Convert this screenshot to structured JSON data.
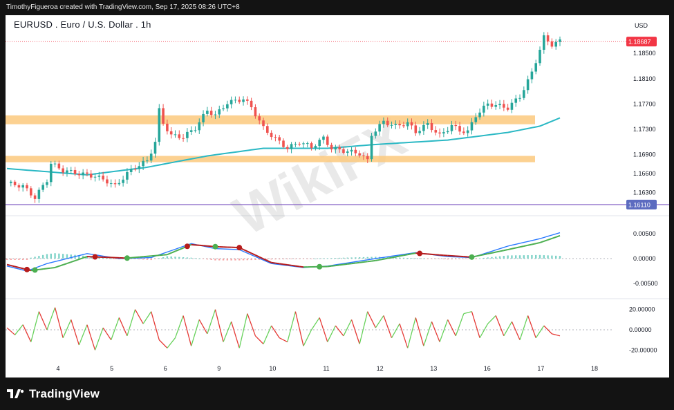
{
  "header": {
    "attribution": "TimothyFigueroa created with TradingView.com, Sep 17, 2025 08:26 UTC+8"
  },
  "chart_title": "EURUSD . Euro / U.S. Dollar . 1h",
  "currency_label": "USD",
  "brand": {
    "name": "TradingView",
    "watermark": "WikiFX"
  },
  "colors": {
    "up": "#26a69a",
    "down": "#ef5350",
    "ma": "#2ab8c4",
    "zone": "#fcc97e",
    "macd_line": "#2979ff",
    "signal_up": "#4caf50",
    "signal_down": "#b71c1c",
    "rsi_up": "#66d15a",
    "rsi_down": "#e53935",
    "support_line": "#7e57c2",
    "last_price_tag": "#f23645",
    "support_tag": "#5c6bc0"
  },
  "chart_data": {
    "type": "candlestick",
    "timeframe": "1h",
    "x_ticks": [
      "4",
      "5",
      "6",
      "9",
      "10",
      "11",
      "12",
      "13",
      "16",
      "17",
      "18"
    ],
    "price_axis": {
      "ticks": [
        "1.18500",
        "1.18100",
        "1.17700",
        "1.17300",
        "1.16900",
        "1.16600",
        "1.16300"
      ],
      "ylim": [
        1.16,
        1.1895
      ]
    },
    "last_price": "1.18687",
    "support_level": "1.16110",
    "zones": [
      {
        "low": 1.1738,
        "high": 1.1752
      },
      {
        "low": 1.1678,
        "high": 1.1688
      }
    ],
    "price_path": [
      [
        0,
        1.1645
      ],
      [
        4,
        1.164
      ],
      [
        7,
        1.1622
      ],
      [
        10,
        1.165
      ],
      [
        11,
        1.1676
      ],
      [
        14,
        1.1665
      ],
      [
        18,
        1.166
      ],
      [
        22,
        1.1656
      ],
      [
        25,
        1.1648
      ],
      [
        27,
        1.164
      ],
      [
        30,
        1.166
      ],
      [
        32,
        1.167
      ],
      [
        35,
        1.168
      ],
      [
        37,
        1.171
      ],
      [
        38,
        1.176
      ],
      [
        39,
        1.174
      ],
      [
        41,
        1.172
      ],
      [
        44,
        1.1718
      ],
      [
        47,
        1.1732
      ],
      [
        50,
        1.176
      ],
      [
        52,
        1.1752
      ],
      [
        55,
        1.1772
      ],
      [
        59,
        1.1778
      ],
      [
        61,
        1.1765
      ],
      [
        64,
        1.1732
      ],
      [
        67,
        1.1715
      ],
      [
        70,
        1.17
      ],
      [
        73,
        1.171
      ],
      [
        76,
        1.1702
      ],
      [
        79,
        1.1716
      ],
      [
        81,
        1.17
      ],
      [
        85,
        1.1695
      ],
      [
        88,
        1.1692
      ],
      [
        90,
        1.168
      ],
      [
        91,
        1.1722
      ],
      [
        94,
        1.1742
      ],
      [
        97,
        1.1735
      ],
      [
        100,
        1.174
      ],
      [
        102,
        1.1726
      ],
      [
        105,
        1.1738
      ],
      [
        108,
        1.172
      ],
      [
        111,
        1.1736
      ],
      [
        113,
        1.1728
      ],
      [
        115,
        1.1726
      ],
      [
        117,
        1.1752
      ],
      [
        120,
        1.177
      ],
      [
        122,
        1.1768
      ],
      [
        125,
        1.1764
      ],
      [
        128,
        1.1782
      ],
      [
        130,
        1.1806
      ],
      [
        131,
        1.182
      ],
      [
        133,
        1.1856
      ],
      [
        134,
        1.1875
      ],
      [
        136,
        1.1864
      ],
      [
        138,
        1.1869
      ]
    ],
    "ma_path": [
      [
        0,
        1.1668
      ],
      [
        20,
        1.1658
      ],
      [
        35,
        1.167
      ],
      [
        50,
        1.1688
      ],
      [
        64,
        1.17
      ],
      [
        80,
        1.17
      ],
      [
        92,
        1.1706
      ],
      [
        110,
        1.1713
      ],
      [
        125,
        1.1725
      ],
      [
        133,
        1.1735
      ],
      [
        138,
        1.1748
      ]
    ],
    "macd": {
      "ticks": [
        "0.00500",
        "0.00000",
        "-0.00500"
      ],
      "ylim": [
        -0.0075,
        0.0075
      ],
      "macd_path": [
        [
          0,
          -0.0015
        ],
        [
          5,
          -0.0025
        ],
        [
          10,
          -0.001
        ],
        [
          20,
          0.001
        ],
        [
          28,
          0.0
        ],
        [
          36,
          0.0002
        ],
        [
          46,
          0.003
        ],
        [
          52,
          0.002
        ],
        [
          58,
          0.0018
        ],
        [
          66,
          -0.001
        ],
        [
          74,
          -0.0018
        ],
        [
          80,
          -0.0015
        ],
        [
          92,
          0.0
        ],
        [
          102,
          0.0012
        ],
        [
          110,
          0.0004
        ],
        [
          116,
          0.0002
        ],
        [
          125,
          0.0025
        ],
        [
          133,
          0.004
        ],
        [
          138,
          0.0052
        ]
      ],
      "signal_path": [
        [
          0,
          -0.0012
        ],
        [
          6,
          -0.0024
        ],
        [
          12,
          -0.0018
        ],
        [
          20,
          0.0004
        ],
        [
          30,
          0.0001
        ],
        [
          40,
          0.0008
        ],
        [
          46,
          0.0028
        ],
        [
          52,
          0.0024
        ],
        [
          58,
          0.0022
        ],
        [
          66,
          -0.0008
        ],
        [
          74,
          -0.0017
        ],
        [
          80,
          -0.0016
        ],
        [
          92,
          -0.0004
        ],
        [
          102,
          0.0011
        ],
        [
          110,
          0.0006
        ],
        [
          116,
          0.0003
        ],
        [
          125,
          0.0018
        ],
        [
          133,
          0.0032
        ],
        [
          138,
          0.0046
        ]
      ],
      "cross_points": [
        {
          "x": 5,
          "dir": "down"
        },
        {
          "x": 7,
          "dir": "up"
        },
        {
          "x": 22,
          "dir": "down"
        },
        {
          "x": 30,
          "dir": "up"
        },
        {
          "x": 45,
          "dir": "down"
        },
        {
          "x": 52,
          "dir": "up"
        },
        {
          "x": 58,
          "dir": "down"
        },
        {
          "x": 78,
          "dir": "up"
        },
        {
          "x": 103,
          "dir": "down"
        },
        {
          "x": 116,
          "dir": "up"
        }
      ]
    },
    "rsi_osc": {
      "ticks": [
        "20.00000",
        "0.00000",
        "-20.00000"
      ],
      "ylim": [
        -28,
        28
      ],
      "path": [
        [
          0,
          2
        ],
        [
          2,
          -5
        ],
        [
          4,
          5
        ],
        [
          6,
          -12
        ],
        [
          8,
          18
        ],
        [
          10,
          0
        ],
        [
          12,
          22
        ],
        [
          14,
          -8
        ],
        [
          16,
          10
        ],
        [
          18,
          -15
        ],
        [
          20,
          5
        ],
        [
          22,
          -20
        ],
        [
          24,
          2
        ],
        [
          26,
          -10
        ],
        [
          28,
          12
        ],
        [
          30,
          -6
        ],
        [
          32,
          20
        ],
        [
          34,
          6
        ],
        [
          36,
          18
        ],
        [
          38,
          -10
        ],
        [
          40,
          -18
        ],
        [
          42,
          -8
        ],
        [
          44,
          14
        ],
        [
          46,
          -16
        ],
        [
          48,
          10
        ],
        [
          50,
          -4
        ],
        [
          52,
          20
        ],
        [
          54,
          -12
        ],
        [
          56,
          8
        ],
        [
          58,
          -18
        ],
        [
          60,
          16
        ],
        [
          62,
          -6
        ],
        [
          64,
          -14
        ],
        [
          66,
          4
        ],
        [
          68,
          -8
        ],
        [
          70,
          -12
        ],
        [
          72,
          18
        ],
        [
          74,
          -16
        ],
        [
          76,
          0
        ],
        [
          78,
          12
        ],
        [
          80,
          -12
        ],
        [
          82,
          4
        ],
        [
          84,
          -6
        ],
        [
          86,
          10
        ],
        [
          88,
          -14
        ],
        [
          90,
          18
        ],
        [
          92,
          2
        ],
        [
          94,
          14
        ],
        [
          96,
          -8
        ],
        [
          98,
          6
        ],
        [
          100,
          -18
        ],
        [
          102,
          12
        ],
        [
          104,
          -16
        ],
        [
          106,
          8
        ],
        [
          108,
          -12
        ],
        [
          110,
          10
        ],
        [
          112,
          -6
        ],
        [
          114,
          16
        ],
        [
          116,
          18
        ],
        [
          118,
          -8
        ],
        [
          120,
          6
        ],
        [
          122,
          14
        ],
        [
          124,
          -6
        ],
        [
          126,
          8
        ],
        [
          128,
          -10
        ],
        [
          130,
          14
        ],
        [
          132,
          -8
        ],
        [
          134,
          4
        ],
        [
          136,
          -4
        ],
        [
          138,
          -6
        ]
      ]
    }
  }
}
